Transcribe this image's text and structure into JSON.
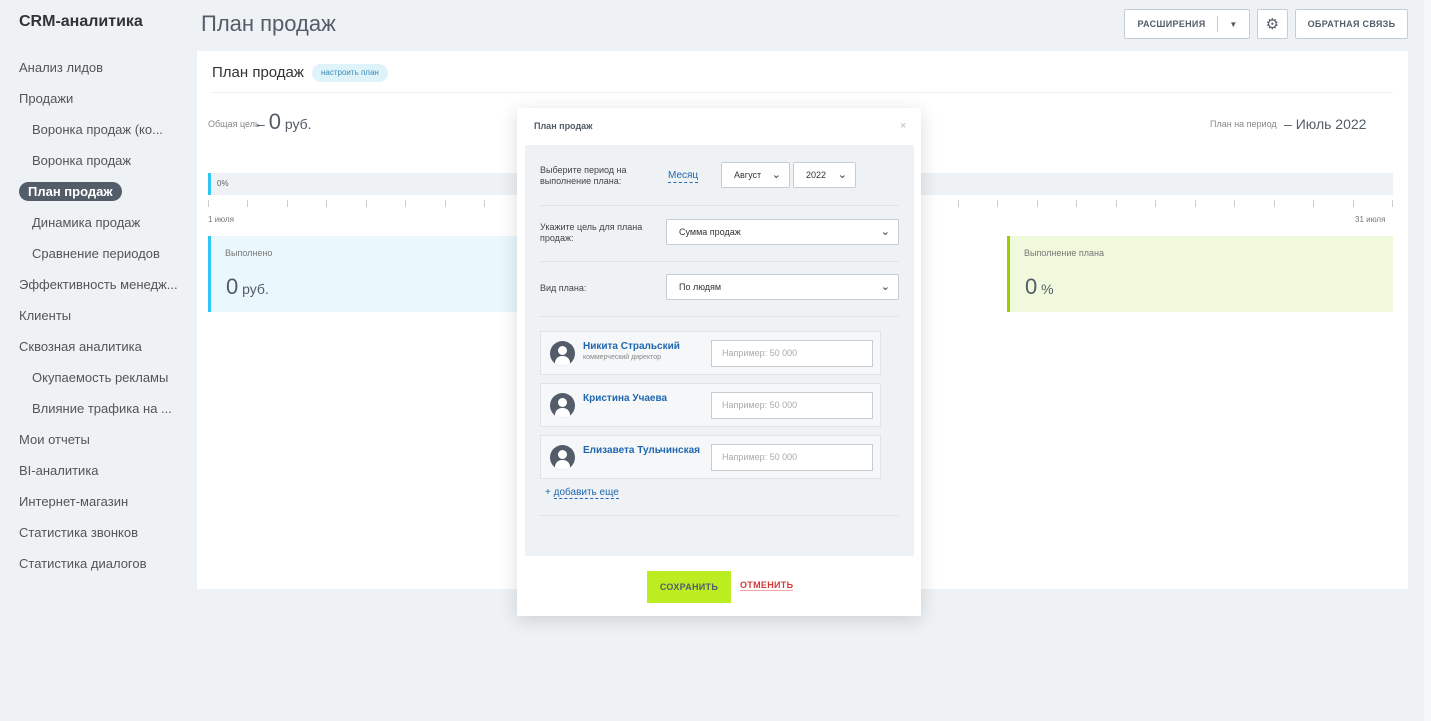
{
  "app": {
    "title": "CRM-аналитика"
  },
  "sidebar": {
    "items": [
      {
        "label": "Анализ лидов",
        "sub": false
      },
      {
        "label": "Продажи",
        "sub": false
      },
      {
        "label": "Воронка продаж (ко...",
        "sub": true
      },
      {
        "label": "Воронка продаж",
        "sub": true
      },
      {
        "label": "План продаж",
        "sub": true,
        "active": true
      },
      {
        "label": "Динамика продаж",
        "sub": true
      },
      {
        "label": "Сравнение периодов",
        "sub": true
      },
      {
        "label": "Эффективность менедж...",
        "sub": false
      },
      {
        "label": "Клиенты",
        "sub": false
      },
      {
        "label": "Сквозная аналитика",
        "sub": false
      },
      {
        "label": "Окупаемость рекламы",
        "sub": true
      },
      {
        "label": "Влияние трафика на ...",
        "sub": true
      },
      {
        "label": "Мои отчеты",
        "sub": false
      },
      {
        "label": "BI-аналитика",
        "sub": false
      },
      {
        "label": "Интернет-магазин",
        "sub": false
      },
      {
        "label": "Статистика звонков",
        "sub": false
      },
      {
        "label": "Статистика диалогов",
        "sub": false
      }
    ]
  },
  "header": {
    "title": "План продаж",
    "extensions_label": "РАСШИРЕНИЯ",
    "feedback_label": "ОБРАТНАЯ СВЯЗЬ"
  },
  "plan": {
    "title": "План продаж",
    "config_label": "настроить план",
    "goal_label": "Общая цель",
    "goal_dash": "–",
    "goal_value": "0",
    "goal_unit": "руб.",
    "period_label": "План на период",
    "period_dash": "–",
    "period_value": "Июль 2022",
    "progress_text": "0%",
    "progress_fraction": 0.0,
    "start_date": "1 июля",
    "end_date": "31 июля",
    "done_label": "Выполнено",
    "done_value": "0",
    "done_unit": "руб.",
    "plan_exec_label": "Выполнение плана",
    "plan_exec_value": "0",
    "plan_exec_unit": "%"
  },
  "modal": {
    "title": "План продаж",
    "close": "×",
    "period_label": "Выберите период на выполнение плана:",
    "period_type": "Месяц",
    "month": "Август",
    "year": "2022",
    "target_label": "Укажите цель для плана продаж:",
    "target_value": "Сумма продаж",
    "plan_type_label": "Вид плана:",
    "plan_type_value": "По людям",
    "people": [
      {
        "name": "Никита Стральский",
        "role": "коммерческий директор",
        "placeholder": "Например: 50 000"
      },
      {
        "name": "Кристина Учаева",
        "role": "",
        "placeholder": "Например: 50 000"
      },
      {
        "name": "Елизавета Тульчинская",
        "role": "",
        "placeholder": "Например: 50 000"
      }
    ],
    "add_more": "добавить еще",
    "add_prefix": "+",
    "save_label": "СОХРАНИТЬ",
    "cancel_label": "ОТМЕНИТЬ"
  },
  "colors": {
    "accent_blue": "#2fc6f6",
    "accent_green": "#9dcf00",
    "save_green": "#bbed21",
    "link": "#2067b0",
    "cancel_red": "#d23a3a"
  },
  "icons": {
    "gear": "gear-icon",
    "close": "close-icon",
    "chevron": "chevron-down-icon",
    "avatar": "user-avatar-icon"
  }
}
